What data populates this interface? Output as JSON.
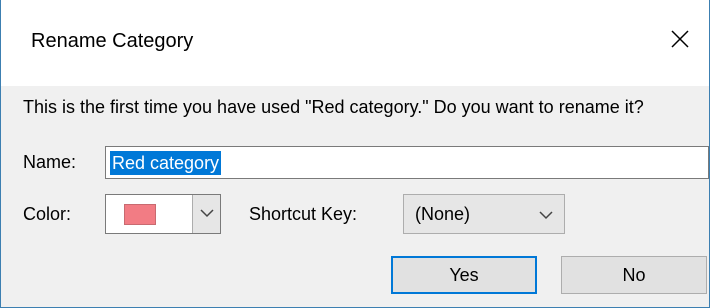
{
  "dialog": {
    "title": "Rename Category",
    "message": "This is the first time you have used \"Red category.\" Do you want to rename it?",
    "name_label": "Name:",
    "name_value": "Red category",
    "color_label": "Color:",
    "color_value": "#f27c84",
    "shortcut_label": "Shortcut Key:",
    "shortcut_value": "(None)",
    "yes_label": "Yes",
    "no_label": "No"
  },
  "icons": {
    "close": "close-icon",
    "color_dropdown": "chevron-down-icon",
    "shortcut_dropdown": "chevron-down-icon"
  },
  "colors": {
    "accent": "#0078d7",
    "border": "#3c7fb1",
    "body_background": "#f0f0f0"
  }
}
